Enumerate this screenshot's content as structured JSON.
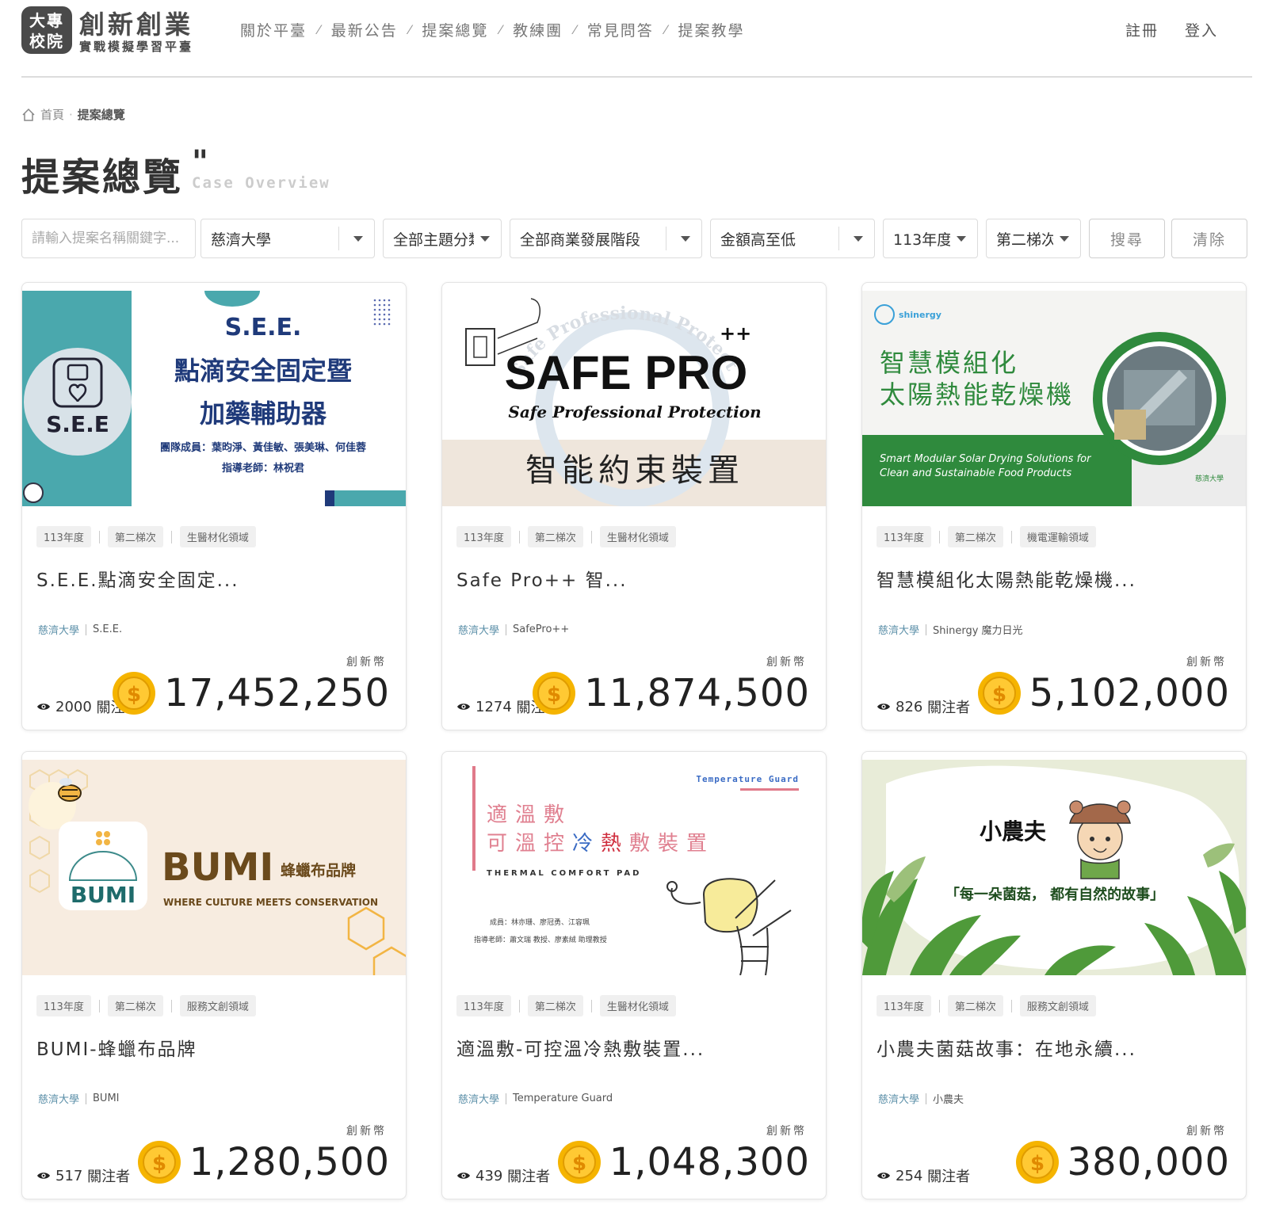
{
  "brand": {
    "badge_line1": "大專",
    "badge_line2": "校院",
    "title": "創新創業",
    "subtitle": "實戰模擬學習平臺"
  },
  "nav": {
    "items": [
      "關於平臺",
      "最新公告",
      "提案總覽",
      "教練團",
      "常見問答",
      "提案教學"
    ],
    "separator": "⁄"
  },
  "auth": {
    "register": "註冊",
    "login": "登入"
  },
  "breadcrumb": {
    "home": "首頁",
    "dot": "·",
    "current": "提案總覽"
  },
  "page": {
    "title": "提案總覽",
    "quote": "\"",
    "subtitle": "Case Overview"
  },
  "filters": {
    "search_placeholder": "請輸入提案名稱關鍵字...",
    "school": "慈濟大學",
    "topic": "全部主題分類",
    "stage": "全部商業發展階段",
    "sort": "金額高至低",
    "year": "113年度",
    "round": "第二梯次",
    "search_button": "搜尋",
    "clear_button": "清除"
  },
  "labels": {
    "coin": "創新幣",
    "followers_suffix": "關注者"
  },
  "colors": {
    "coin": "#f5b400",
    "school_link": "#5b8fa8",
    "bumi_brown": "#6b4a1c",
    "see_teal": "#4aa8ad",
    "green": "#2f8a3d"
  },
  "cards": [
    {
      "year": "113年度",
      "round": "第二梯次",
      "field": "生醫材化領域",
      "title": "S.E.E.點滴安全固定...",
      "school": "慈濟大學",
      "team": "S.E.E.",
      "followers": "2000",
      "amount": "17,452,250",
      "image": {
        "heading": "S.E.E.",
        "line1": "點滴安全固定暨",
        "line2": "加藥輔助器",
        "members": "團隊成員：葉昀淨、黃佳敏、張美琳、何佳蓉",
        "advisor": "指導老師：林祝君",
        "logo_text": "S.E.E"
      }
    },
    {
      "year": "113年度",
      "round": "第二梯次",
      "field": "生醫材化領域",
      "title": "Safe Pro++ 智...",
      "school": "慈濟大學",
      "team": "SafePro++",
      "followers": "1274",
      "amount": "11,874,500",
      "image": {
        "heading": "SAFE PRO",
        "plus": "++",
        "arc": "Safe Professional Protection",
        "sub": "Safe Professional Protection",
        "chinese": "智能約束裝置"
      }
    },
    {
      "year": "113年度",
      "round": "第二梯次",
      "field": "機電運輸領域",
      "title": "智慧模組化太陽熱能乾燥機...",
      "school": "慈濟大學",
      "team": "Shinergy 魔力日光",
      "followers": "826",
      "amount": "5,102,000",
      "image": {
        "brand": "shinergy",
        "line1": "智慧模組化",
        "line2": "太陽熱能乾燥機",
        "en1": "Smart Modular Solar Drying Solutions for",
        "en2": "Clean and Sustainable Food Products",
        "uni": "慈濟大學"
      }
    },
    {
      "year": "113年度",
      "round": "第二梯次",
      "field": "服務文創領域",
      "title": "BUMI-蜂蠟布品牌",
      "school": "慈濟大學",
      "team": "BUMI",
      "followers": "517",
      "amount": "1,280,500",
      "image": {
        "logo": "BUMI",
        "brand": "BUMI",
        "tagline": "蜂蠟布品牌",
        "slogan": "WHERE CULTURE MEETS CONSERVATION"
      }
    },
    {
      "year": "113年度",
      "round": "第二梯次",
      "field": "生醫材化領域",
      "title": "適溫敷-可控溫冷熱敷裝置...",
      "school": "慈濟大學",
      "team": "Temperature Guard",
      "followers": "439",
      "amount": "1,048,300",
      "image": {
        "corner": "Temperature Guard",
        "line1": "適溫敷",
        "line2a": "可溫控",
        "line2b": "冷",
        "line2c": "熱",
        "line2d": "敷裝置",
        "en": "THERMAL COMFORT PAD",
        "members": "成員：林亦珊、廖冠勇、江容珮",
        "advisor": "指導老師：蕭文瑞 教授、廖素絨 助理教授"
      }
    },
    {
      "year": "113年度",
      "round": "第二梯次",
      "field": "服務文創領域",
      "title": "小農夫菌菇故事：在地永續...",
      "school": "慈濟大學",
      "team": "小農夫",
      "followers": "254",
      "amount": "380,000",
      "image": {
        "heading": "小農夫",
        "quote": "「每一朵菌菇， 都有自然的故事」"
      }
    }
  ]
}
